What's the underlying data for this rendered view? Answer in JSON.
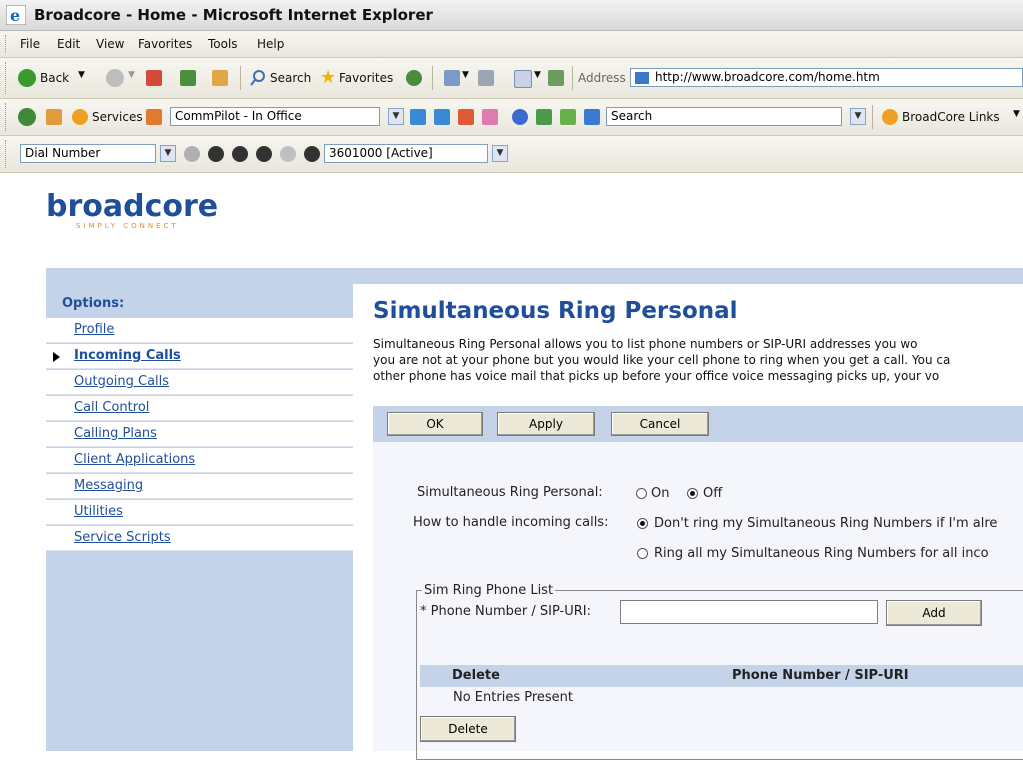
{
  "window": {
    "title": "Broadcore - Home - Microsoft Internet Explorer"
  },
  "menu": [
    "File",
    "Edit",
    "View",
    "Favorites",
    "Tools",
    "Help"
  ],
  "nav_toolbar": {
    "back_label": "Back",
    "search_label": "Search",
    "favorites_label": "Favorites",
    "address_label": "Address",
    "address_value": "http://www.broadcore.com/home.htm"
  },
  "commpilot_toolbar": {
    "services_label": "Services",
    "profile_select": "CommPilot - In Office",
    "search_select": "Search",
    "links_label": "BroadCore Links"
  },
  "dial_toolbar": {
    "dial_select": "Dial Number",
    "line_select": "3601000 [Active]"
  },
  "logo": {
    "name": "broadcore",
    "tagline": "SIMPLY CONNECT"
  },
  "sidebar": {
    "options_label": "Options:",
    "items": [
      {
        "label": "Profile",
        "active": false
      },
      {
        "label": "Incoming Calls",
        "active": true
      },
      {
        "label": "Outgoing Calls",
        "active": false
      },
      {
        "label": "Call Control",
        "active": false
      },
      {
        "label": "Calling Plans",
        "active": false
      },
      {
        "label": "Client Applications",
        "active": false
      },
      {
        "label": "Messaging",
        "active": false
      },
      {
        "label": "Utilities",
        "active": false
      },
      {
        "label": "Service Scripts",
        "active": false
      }
    ]
  },
  "page": {
    "title": "Simultaneous Ring Personal",
    "description": [
      "Simultaneous Ring Personal allows you to list phone numbers or SIP-URI addresses you wo",
      "you are not at your phone but you would like your cell phone to ring when you get a call. You ca",
      "other phone has voice mail that picks up before your office voice messaging picks up, your vo"
    ]
  },
  "buttons": {
    "ok": "OK",
    "apply": "Apply",
    "cancel": "Cancel",
    "add": "Add",
    "delete": "Delete"
  },
  "form": {
    "sim_ring_label": "Simultaneous Ring Personal:",
    "on_label": "On",
    "off_label": "Off",
    "sim_ring_value": "Off",
    "handle_label": "How to handle incoming calls:",
    "handle_option_1": "Don't ring my Simultaneous Ring Numbers if I'm alre",
    "handle_option_2": "Ring all my Simultaneous Ring Numbers for all inco",
    "handle_value": "option_1",
    "list_legend": "Sim Ring Phone List",
    "phone_label": "* Phone Number / SIP-URI:",
    "phone_value": ""
  },
  "table": {
    "headers": [
      "Delete",
      "Phone Number / SIP-URI"
    ],
    "empty_text": "No Entries Present"
  },
  "colors": {
    "accent_blue": "#1f4f9a",
    "panel_blue": "#c5d3e9"
  }
}
